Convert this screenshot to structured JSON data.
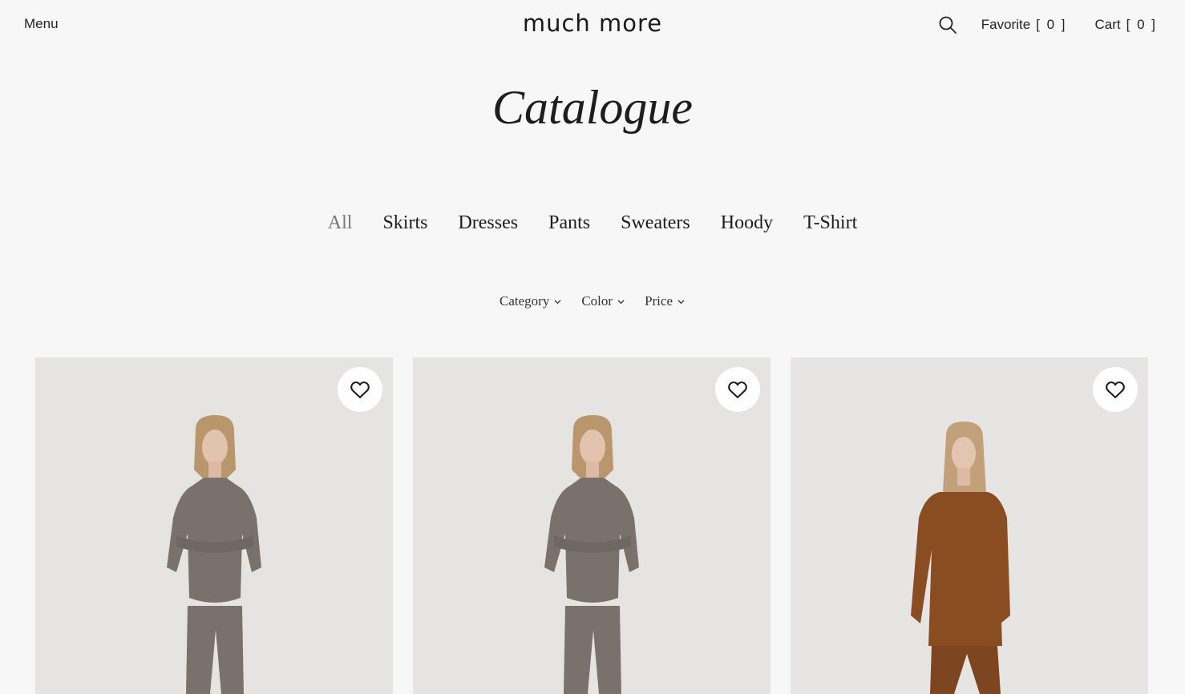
{
  "header": {
    "menu_label": "Menu",
    "logo_text": "much more",
    "favorite_label": "Favorite",
    "favorite_count": "[ 0 ]",
    "cart_label": "Cart",
    "cart_count": "[ 0 ]",
    "search_icon": "search-icon"
  },
  "page_title": "Catalogue",
  "tabs": [
    {
      "label": "All",
      "active": true
    },
    {
      "label": "Skirts"
    },
    {
      "label": "Dresses"
    },
    {
      "label": "Pants"
    },
    {
      "label": "Sweaters"
    },
    {
      "label": "Hoody"
    },
    {
      "label": "T-Shirt"
    }
  ],
  "filters": [
    {
      "label": "Category"
    },
    {
      "label": "Color"
    },
    {
      "label": "Price"
    }
  ],
  "products": [
    {
      "garment_color": "#7a716c",
      "favorite_icon": "heart-icon"
    },
    {
      "garment_color": "#7a716c",
      "favorite_icon": "heart-icon"
    },
    {
      "garment_color": "#8a4d22",
      "favorite_icon": "heart-icon"
    }
  ],
  "colors": {
    "background": "#f7f7f7",
    "text": "#1f1f1f",
    "active_tab": "#777777",
    "photo_background": "#e6e4e1"
  }
}
